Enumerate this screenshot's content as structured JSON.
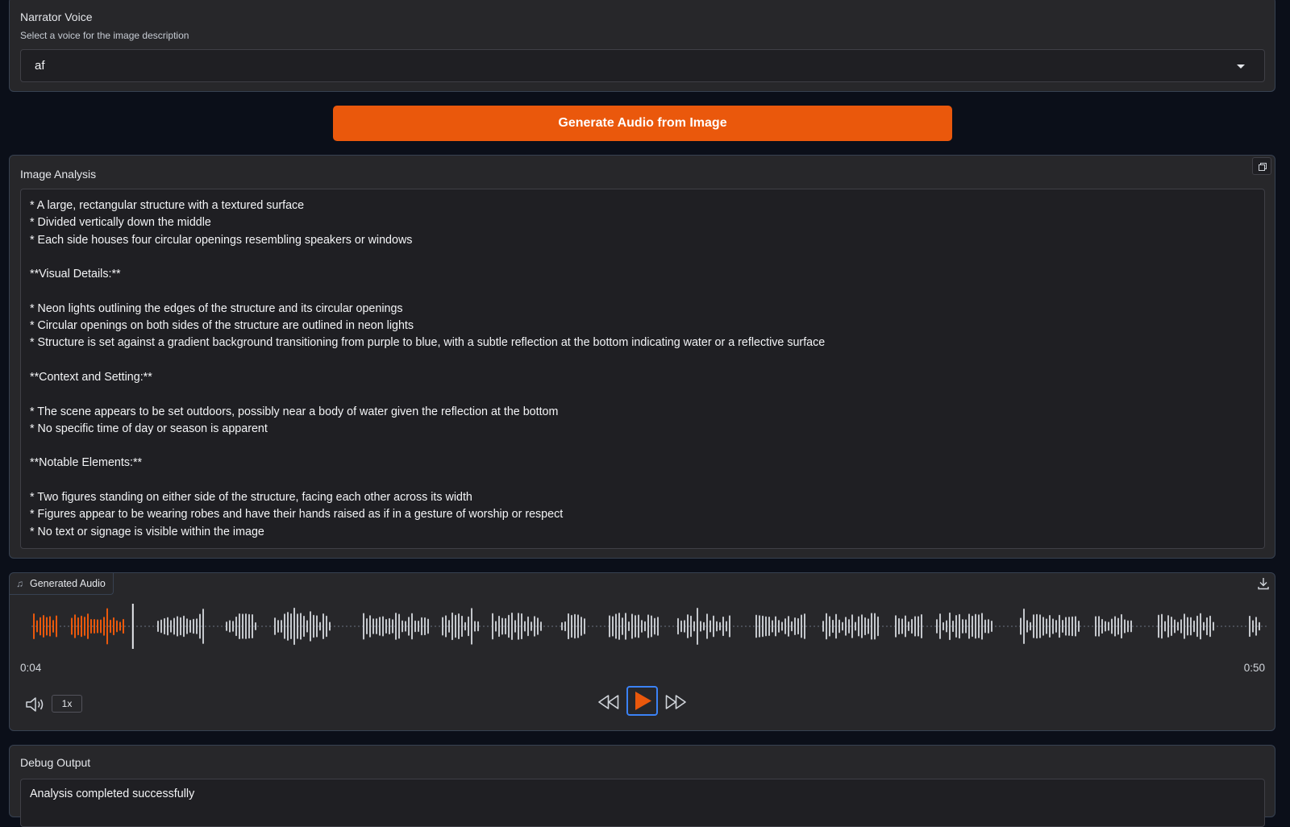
{
  "narrator": {
    "label": "Narrator Voice",
    "description": "Select a voice for the image description",
    "selected": "af"
  },
  "generate_button": "Generate Audio from Image",
  "analysis": {
    "label": "Image Analysis",
    "lines": [
      "* A large, rectangular structure with a textured surface",
      "* Divided vertically down the middle",
      "* Each side houses four circular openings resembling speakers or windows",
      "",
      "**Visual Details:**",
      "",
      "* Neon lights outlining the edges of the structure and its circular openings",
      "* Circular openings on both sides of the structure are outlined in neon lights",
      "* Structure is set against a gradient background transitioning from purple to blue, with a subtle reflection at the bottom indicating water or a reflective surface",
      "",
      "**Context and Setting:**",
      "",
      "* The scene appears to be set outdoors, possibly near a body of water given the reflection at the bottom",
      "* No specific time of day or season is apparent",
      "",
      "**Notable Elements:**",
      "",
      "* Two figures standing on either side of the structure, facing each other across its width",
      "* Figures appear to be wearing robes and have their hands raised as if in a gesture of worship or respect",
      "* No text or signage is visible within the image"
    ]
  },
  "audio": {
    "label": "Generated Audio",
    "current_time": "0:04",
    "total_time": "0:50",
    "playback_rate": "1x",
    "progress": 0.08,
    "colors": {
      "played": "#ea580c",
      "unplayed": "#c4c7cc",
      "accent": "#ea580c",
      "focus": "#3b82f6"
    }
  },
  "debug": {
    "label": "Debug Output",
    "value": "Analysis completed successfully"
  }
}
